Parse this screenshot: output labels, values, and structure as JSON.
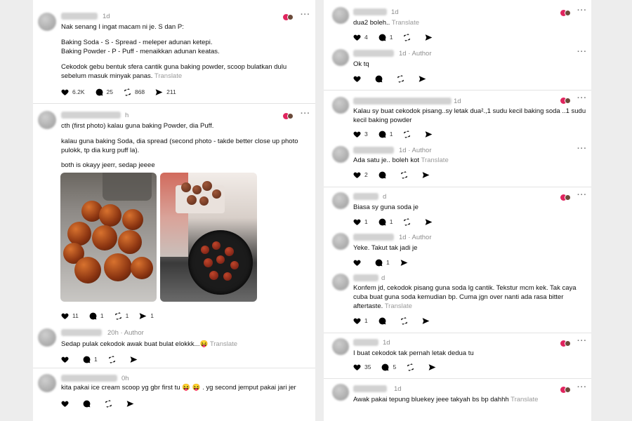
{
  "left": {
    "post1": {
      "time": "1d",
      "lines": [
        "Nak senang I ingat macam ni je. S dan P:",
        "Baking Soda - S - Spread - meleper adunan ketepi.",
        "Baking Powder - P - Puff - menaikkan adunan keatas.",
        "Cekodok gebu bentuk sfera cantik guna baking powder, scoop bulatkan dulu",
        "sebelum masuk minyak panas."
      ],
      "translate": "Translate",
      "likes": "6.2K",
      "replies": "25",
      "reposts": "868",
      "shares": "211"
    },
    "post2": {
      "time": "h",
      "lines": [
        "cth (first photo) kalau guna baking Powder, dia Puff.",
        "kalau guna baking Soda, dia spread (second photo - takde better close up photo",
        "pulokk, tp dia kurg puff la).",
        "both is okayy jeerr, sedap jeeee"
      ],
      "likes": "11",
      "replies": "1",
      "reposts": "1",
      "shares": "1"
    },
    "reply1": {
      "time": "20h",
      "author": "Author",
      "text": "Sedap pulak cekodok awak buat bulat elokkk...😝",
      "translate": "Translate",
      "replies": "1"
    },
    "reply2": {
      "time": "0h",
      "text": "kita pakai ice cream scoop yg gbr first tu 😝 😝 . yg second jemput pakai jari jer"
    }
  },
  "right": {
    "c1": {
      "time": "1d",
      "text": "dua2 boleh..",
      "translate": "Translate",
      "likes": "4",
      "replies": "1"
    },
    "c2": {
      "time": "1d",
      "author": "Author",
      "text": "Ok tq"
    },
    "c3": {
      "time": "1d",
      "lines": [
        "Kalau sy buat cekodok pisang..sy letak dua².,1 sudu kecil baking soda ..1 sudu",
        "kecil baking powder"
      ],
      "likes": "3",
      "replies": "1"
    },
    "c4": {
      "time": "1d",
      "author": "Author",
      "text": "Ada satu je.. boleh kot",
      "translate": "Translate",
      "likes": "2"
    },
    "c5": {
      "time": "d",
      "text": "Biasa sy guna soda je",
      "likes": "1",
      "replies": "1"
    },
    "c6": {
      "time": "1d",
      "author": "Author",
      "text": "Yeke. Takut tak jadi je",
      "replies": "1"
    },
    "c7": {
      "time": "d",
      "lines": [
        "Konfem jd, cekodok pisang guna soda lg cantik. Tekstur mcm kek. Tak caya",
        "cuba buat guna soda kemudian bp. Cuma jgn over nanti ada rasa bitter",
        "aftertaste."
      ],
      "translate": "Translate",
      "likes": "1"
    },
    "c8": {
      "time": "1d",
      "text": "I buat cekodok tak pernah letak dedua tu",
      "likes": "35",
      "replies": "5"
    },
    "c9": {
      "time": "1d",
      "text": "Awak pakai tepung bluekey jeee takyah bs bp dahhh",
      "translate": "Translate"
    }
  },
  "icons": {
    "like": "heart-icon",
    "reply": "comment-icon",
    "repost": "repost-icon",
    "share": "share-icon",
    "more": "more-icon"
  },
  "colors": {
    "background": "#ededed",
    "card": "#ffffff",
    "muted": "#8e8e8e",
    "heart": "#e0245e"
  }
}
